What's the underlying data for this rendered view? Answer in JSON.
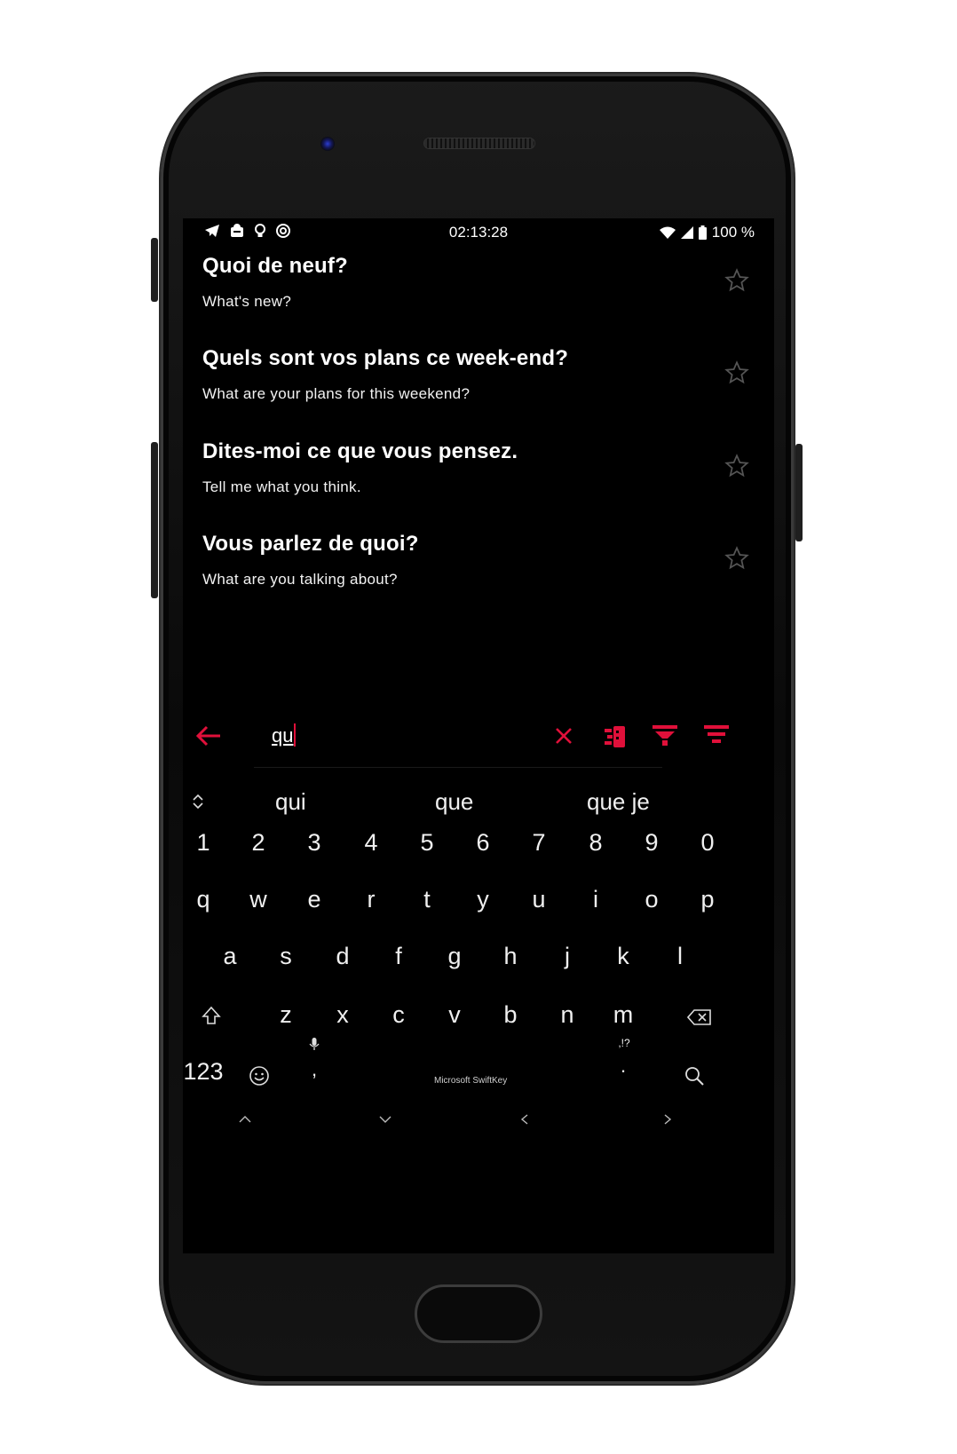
{
  "status_bar": {
    "time": "02:13:28",
    "battery": "100 %",
    "left_icons": [
      "telegram-icon",
      "alert-icon",
      "bulb-icon",
      "sync-icon"
    ],
    "right_icons": [
      "wifi-icon",
      "signal-icon",
      "battery-icon"
    ]
  },
  "phrases": [
    {
      "french": "Quoi de neuf?",
      "english": "What's new?"
    },
    {
      "french": "Quels sont vos plans ce week-end?",
      "english": "What are your plans for this weekend?"
    },
    {
      "french": "Dites-moi ce que vous pensez.",
      "english": "Tell me what you think."
    },
    {
      "french": "Vous parlez de quoi?",
      "english": "What are you talking about?"
    }
  ],
  "search": {
    "query": "qu",
    "icons": [
      "back-arrow-icon",
      "clear-icon",
      "sort-icon",
      "filter-icon",
      "filter-alt-icon"
    ]
  },
  "keyboard": {
    "suggestions": [
      "qui",
      "que",
      "que je"
    ],
    "number_row": [
      "1",
      "2",
      "3",
      "4",
      "5",
      "6",
      "7",
      "8",
      "9",
      "0"
    ],
    "row1": [
      "q",
      "w",
      "e",
      "r",
      "t",
      "y",
      "u",
      "i",
      "o",
      "p"
    ],
    "row2": [
      "a",
      "s",
      "d",
      "f",
      "g",
      "h",
      "j",
      "k",
      "l"
    ],
    "row3": [
      "z",
      "x",
      "c",
      "v",
      "b",
      "n",
      "m"
    ],
    "symbols_key": "123",
    "comma_key": ",",
    "period_key": ".",
    "punct_hint": ",!?",
    "brand": "Microsoft SwiftKey"
  },
  "colors": {
    "accent": "#e0103a",
    "background": "#000000",
    "text": "#ffffff",
    "star": "#555555"
  }
}
